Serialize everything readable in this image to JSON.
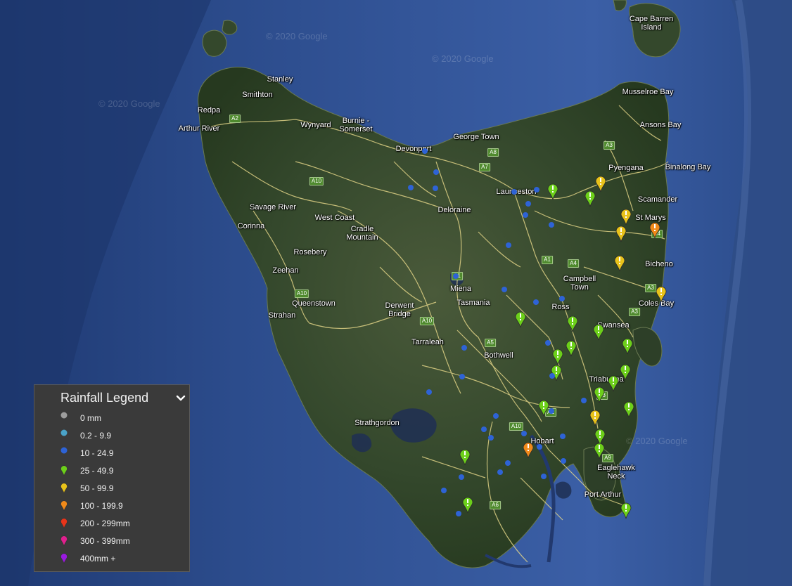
{
  "legend": {
    "title": "Rainfall Legend",
    "toggle_icon": "chevron-down-icon",
    "items": [
      {
        "label": "0 mm",
        "kind": "dot",
        "color": "#9e9e9e"
      },
      {
        "label": "0.2 - 9.9",
        "kind": "dot",
        "color": "#4aa3c8"
      },
      {
        "label": "10 - 24.9",
        "kind": "dot",
        "color": "#2e63d6"
      },
      {
        "label": "25 - 49.9",
        "kind": "pin",
        "color": "#6ccf1a"
      },
      {
        "label": "50 - 99.9",
        "kind": "pin",
        "color": "#e8c21a"
      },
      {
        "label": "100 - 199.9",
        "kind": "pin",
        "color": "#f08a1a"
      },
      {
        "label": "200 - 299mm",
        "kind": "pin",
        "color": "#e8341a"
      },
      {
        "label": "300 - 399mm",
        "kind": "pin",
        "color": "#e0208e"
      },
      {
        "label": "400mm +",
        "kind": "pin",
        "color": "#9a1ae0"
      }
    ]
  },
  "places": [
    {
      "name": "Stanley"
    },
    {
      "name": "Smithton"
    },
    {
      "name": "Redpa"
    },
    {
      "name": "Arthur River"
    },
    {
      "name": "Wynyard"
    },
    {
      "name": "Burnie -\nSomerset"
    },
    {
      "name": "Devonport"
    },
    {
      "name": "George Town"
    },
    {
      "name": "Launceston"
    },
    {
      "name": "Deloraine"
    },
    {
      "name": "Savage River"
    },
    {
      "name": "Corinna"
    },
    {
      "name": "West Coast"
    },
    {
      "name": "Cradle\nMountain"
    },
    {
      "name": "Rosebery"
    },
    {
      "name": "Zeehan"
    },
    {
      "name": "Queenstown"
    },
    {
      "name": "Strahan"
    },
    {
      "name": "Derwent\nBridge"
    },
    {
      "name": "Miena"
    },
    {
      "name": "Tasmania"
    },
    {
      "name": "Tarraleah"
    },
    {
      "name": "Bothwell"
    },
    {
      "name": "Strathgordon"
    },
    {
      "name": "Hobart"
    },
    {
      "name": "Campbell\nTown"
    },
    {
      "name": "Ross"
    },
    {
      "name": "Swansea"
    },
    {
      "name": "Triabunna"
    },
    {
      "name": "Coles Bay"
    },
    {
      "name": "Bicheno"
    },
    {
      "name": "Scamander"
    },
    {
      "name": "St Marys"
    },
    {
      "name": "Pyengana"
    },
    {
      "name": "Binalong Bay"
    },
    {
      "name": "Ansons Bay"
    },
    {
      "name": "Musselroe Bay"
    },
    {
      "name": "Cape Barren\nIsland"
    },
    {
      "name": "Eaglehawk\nNeck"
    },
    {
      "name": "Port Arthur"
    }
  ],
  "roads": [
    "A2",
    "A8",
    "A7",
    "A3",
    "A10",
    "A10",
    "A4",
    "A1",
    "A4",
    "A3",
    "A3",
    "A10",
    "A5",
    "A3",
    "A10",
    "A9",
    "A6",
    "A1",
    "A1"
  ],
  "watermark": "© 2020 Google",
  "stations": [
    {
      "category": 3
    },
    {
      "category": 3
    },
    {
      "category": 4
    },
    {
      "category": 4
    },
    {
      "category": 4
    },
    {
      "category": 5
    },
    {
      "category": 4
    },
    {
      "category": 4
    },
    {
      "category": 3
    },
    {
      "category": 3
    },
    {
      "category": 3
    },
    {
      "category": 3
    },
    {
      "category": 3
    },
    {
      "category": 3
    },
    {
      "category": 3
    },
    {
      "category": 3
    },
    {
      "category": 3
    },
    {
      "category": 3
    },
    {
      "category": 3
    },
    {
      "category": 4
    },
    {
      "category": 3
    },
    {
      "category": 3
    },
    {
      "category": 3
    },
    {
      "category": 5
    },
    {
      "category": 3
    },
    {
      "category": 3
    },
    {
      "category": 3
    },
    {
      "category": 2
    },
    {
      "category": 2
    },
    {
      "category": 2
    },
    {
      "category": 2
    },
    {
      "category": 2
    },
    {
      "category": 2
    },
    {
      "category": 2
    },
    {
      "category": 2
    },
    {
      "category": 2
    },
    {
      "category": 2
    },
    {
      "category": 2
    },
    {
      "category": 2
    },
    {
      "category": 2
    },
    {
      "category": 2
    },
    {
      "category": 2
    },
    {
      "category": 2
    },
    {
      "category": 2
    },
    {
      "category": 2
    },
    {
      "category": 2
    },
    {
      "category": 2
    },
    {
      "category": 2
    },
    {
      "category": 2
    },
    {
      "category": 2
    },
    {
      "category": 2
    },
    {
      "category": 2
    },
    {
      "category": 2
    },
    {
      "category": 2
    },
    {
      "category": 2
    },
    {
      "category": 2
    },
    {
      "category": 2
    },
    {
      "category": 2
    },
    {
      "category": 2
    },
    {
      "category": 2
    },
    {
      "category": 2
    }
  ]
}
